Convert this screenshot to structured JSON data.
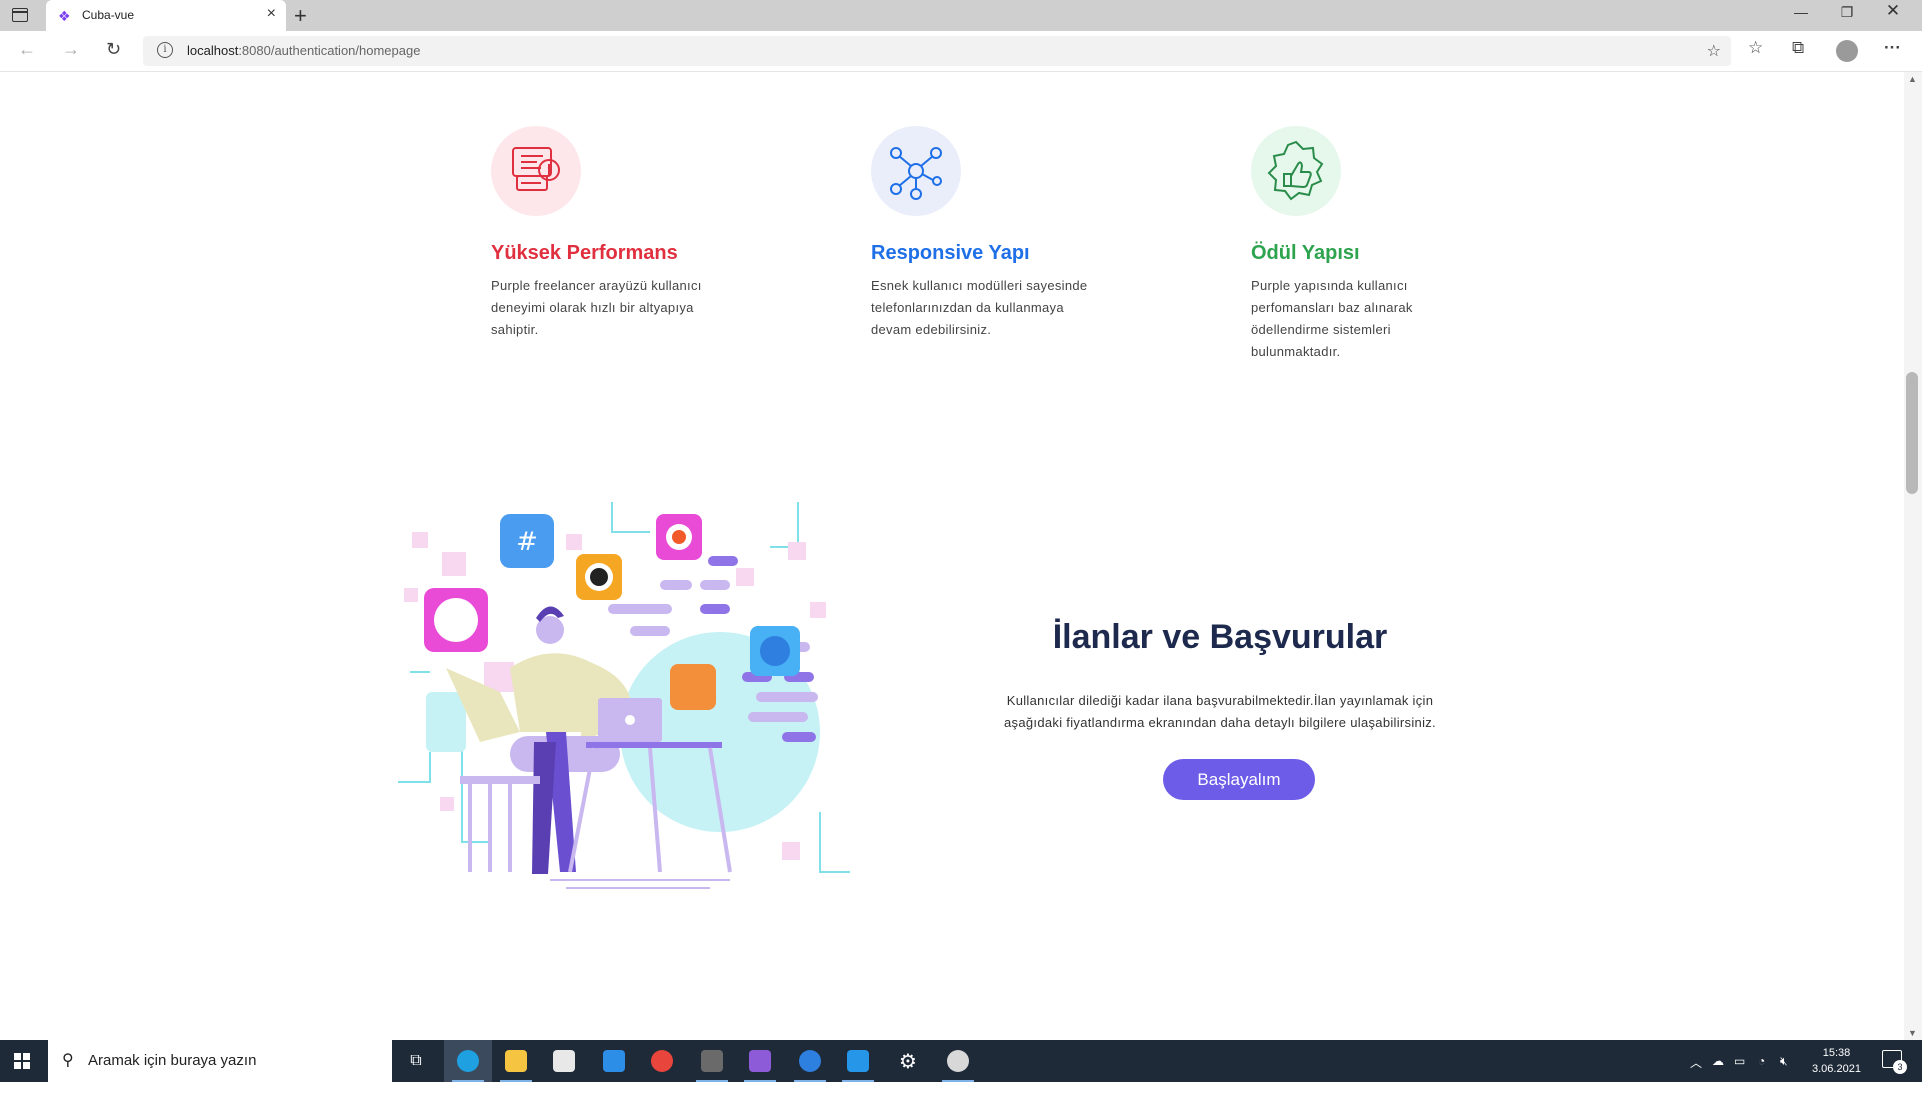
{
  "browser": {
    "tab_title": "Cuba-vue",
    "url_host": "localhost",
    "url_rest": ":8080/authentication/homepage"
  },
  "features": [
    {
      "title": "Yüksek Performans",
      "desc_lines": [
        "Purple freelancer arayüzü kullanıcı",
        "deneyimi olarak hızlı bir altyapıya",
        "sahiptir."
      ],
      "color": "#e0303f",
      "icon": "server-speed-icon"
    },
    {
      "title": "Responsive Yapı",
      "desc_lines": [
        "Esnek kullanıcı modülleri sayesinde",
        "telefonlarınızdan da kullanmaya",
        "devam edebilirsiniz."
      ],
      "color": "#1e6fe8",
      "icon": "network-nodes-icon"
    },
    {
      "title": "Ödül Yapısı",
      "desc_lines": [
        "Purple yapısında kullanıcı",
        "perfomansları baz alınarak",
        "ödellendirme sistemleri",
        "bulunmaktadır."
      ],
      "color": "#2ea44f",
      "icon": "award-badge-icon"
    }
  ],
  "cta": {
    "title": "İlanlar ve Başvurular",
    "text_lines": [
      "Kullanıcılar dilediği kadar ilana başvurabilmektedir.İlan yayınlamak için",
      "aşağıdaki fiyatlandırma ekranından daha detaylı bilgilere ulaşabilirsiniz."
    ],
    "button": "Başlayalım",
    "button_color": "#6c5ce7"
  },
  "taskbar": {
    "search_placeholder": "Aramak için buraya yazın",
    "time": "15:38",
    "date": "3.06.2021",
    "notifications": "3"
  }
}
